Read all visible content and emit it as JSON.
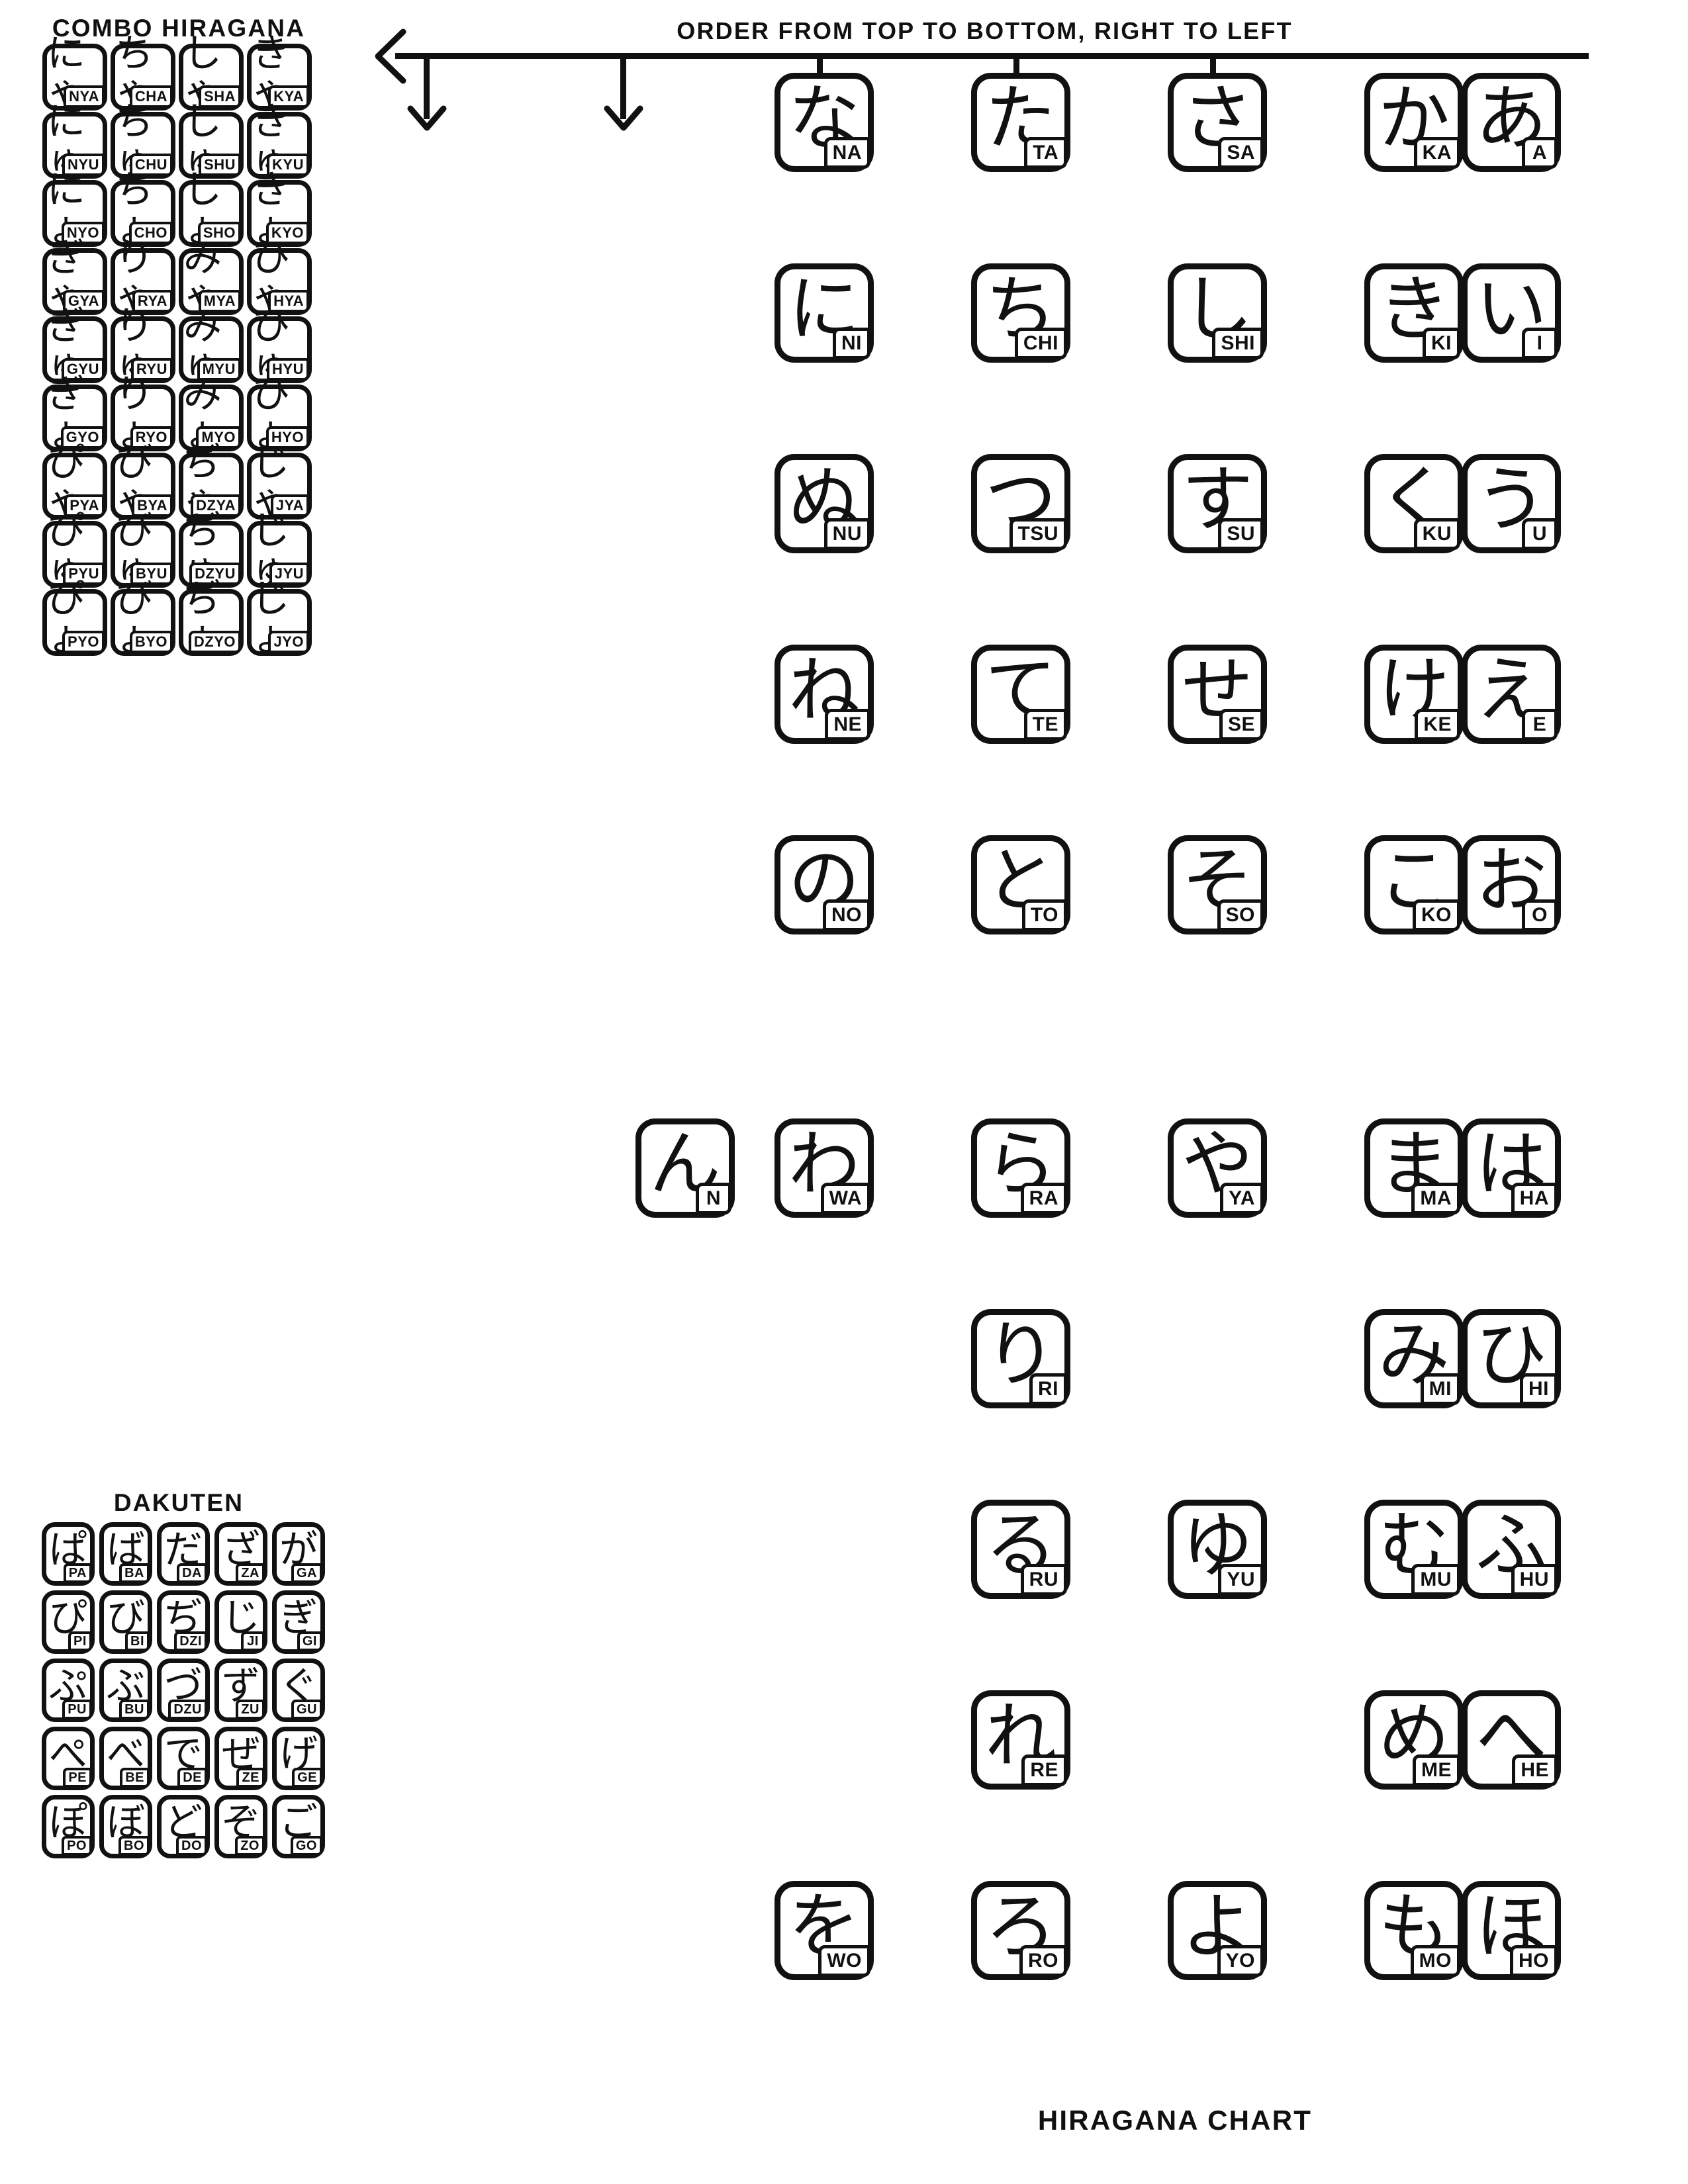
{
  "page": {
    "combo_title": "COMBO HIRAGANA",
    "dakuten_title": "DAKUTEN",
    "order_note": "ORDER FROM TOP TO BOTTOM, RIGHT TO LEFT",
    "chart_title": "HIRAGANA CHART",
    "ink_color": "#111111",
    "paper_color": "#ffffff"
  },
  "combo": {
    "columns": 4,
    "rows": [
      [
        {
          "kana": "にゃ",
          "romaji": "NYA"
        },
        {
          "kana": "ちゃ",
          "romaji": "CHA"
        },
        {
          "kana": "しゃ",
          "romaji": "SHA"
        },
        {
          "kana": "きゃ",
          "romaji": "KYA"
        }
      ],
      [
        {
          "kana": "にゅ",
          "romaji": "NYU"
        },
        {
          "kana": "ちゅ",
          "romaji": "CHU"
        },
        {
          "kana": "しゅ",
          "romaji": "SHU"
        },
        {
          "kana": "きゅ",
          "romaji": "KYU"
        }
      ],
      [
        {
          "kana": "にょ",
          "romaji": "NYO"
        },
        {
          "kana": "ちょ",
          "romaji": "CHO"
        },
        {
          "kana": "しょ",
          "romaji": "SHO"
        },
        {
          "kana": "きょ",
          "romaji": "KYO"
        }
      ],
      [
        {
          "kana": "ぎゃ",
          "romaji": "GYA"
        },
        {
          "kana": "りゃ",
          "romaji": "RYA"
        },
        {
          "kana": "みゃ",
          "romaji": "MYA"
        },
        {
          "kana": "ひゃ",
          "romaji": "HYA"
        }
      ],
      [
        {
          "kana": "ぎゅ",
          "romaji": "GYU"
        },
        {
          "kana": "りゅ",
          "romaji": "RYU"
        },
        {
          "kana": "みゅ",
          "romaji": "MYU"
        },
        {
          "kana": "ひゅ",
          "romaji": "HYU"
        }
      ],
      [
        {
          "kana": "ぎょ",
          "romaji": "GYO"
        },
        {
          "kana": "りょ",
          "romaji": "RYO"
        },
        {
          "kana": "みょ",
          "romaji": "MYO"
        },
        {
          "kana": "ひょ",
          "romaji": "HYO"
        }
      ],
      [
        {
          "kana": "ぴゃ",
          "romaji": "PYA"
        },
        {
          "kana": "びゃ",
          "romaji": "BYA"
        },
        {
          "kana": "ぢゃ",
          "romaji": "DZYA"
        },
        {
          "kana": "じゃ",
          "romaji": "JYA"
        }
      ],
      [
        {
          "kana": "ぴゅ",
          "romaji": "PYU"
        },
        {
          "kana": "びゅ",
          "romaji": "BYU"
        },
        {
          "kana": "ぢゅ",
          "romaji": "DZYU"
        },
        {
          "kana": "じゅ",
          "romaji": "JYU"
        }
      ],
      [
        {
          "kana": "ぴょ",
          "romaji": "PYO"
        },
        {
          "kana": "びょ",
          "romaji": "BYO"
        },
        {
          "kana": "ぢょ",
          "romaji": "DZYO"
        },
        {
          "kana": "じょ",
          "romaji": "JYO"
        }
      ]
    ]
  },
  "dakuten": {
    "columns": 5,
    "rows": [
      [
        {
          "kana": "ぱ",
          "romaji": "PA"
        },
        {
          "kana": "ば",
          "romaji": "BA"
        },
        {
          "kana": "だ",
          "romaji": "DA"
        },
        {
          "kana": "ざ",
          "romaji": "ZA"
        },
        {
          "kana": "が",
          "romaji": "GA"
        }
      ],
      [
        {
          "kana": "ぴ",
          "romaji": "PI"
        },
        {
          "kana": "び",
          "romaji": "BI"
        },
        {
          "kana": "ぢ",
          "romaji": "DZI"
        },
        {
          "kana": "じ",
          "romaji": "JI"
        },
        {
          "kana": "ぎ",
          "romaji": "GI"
        }
      ],
      [
        {
          "kana": "ぷ",
          "romaji": "PU"
        },
        {
          "kana": "ぶ",
          "romaji": "BU"
        },
        {
          "kana": "づ",
          "romaji": "DZU"
        },
        {
          "kana": "ず",
          "romaji": "ZU"
        },
        {
          "kana": "ぐ",
          "romaji": "GU"
        }
      ],
      [
        {
          "kana": "ぺ",
          "romaji": "PE"
        },
        {
          "kana": "べ",
          "romaji": "BE"
        },
        {
          "kana": "で",
          "romaji": "DE"
        },
        {
          "kana": "ぜ",
          "romaji": "ZE"
        },
        {
          "kana": "げ",
          "romaji": "GE"
        }
      ],
      [
        {
          "kana": "ぽ",
          "romaji": "PO"
        },
        {
          "kana": "ぼ",
          "romaji": "BO"
        },
        {
          "kana": "ど",
          "romaji": "DO"
        },
        {
          "kana": "ぞ",
          "romaji": "ZO"
        },
        {
          "kana": "ご",
          "romaji": "GO"
        }
      ]
    ]
  },
  "main": {
    "columns": 5,
    "column_order": [
      "NA",
      "TA",
      "SA",
      "KA",
      "A"
    ],
    "rows": [
      [
        {
          "kana": "な",
          "romaji": "NA"
        },
        {
          "kana": "た",
          "romaji": "TA"
        },
        {
          "kana": "さ",
          "romaji": "SA"
        },
        {
          "kana": "か",
          "romaji": "KA"
        },
        {
          "kana": "あ",
          "romaji": "A"
        }
      ],
      [
        {
          "kana": "に",
          "romaji": "NI"
        },
        {
          "kana": "ち",
          "romaji": "CHI"
        },
        {
          "kana": "し",
          "romaji": "SHI"
        },
        {
          "kana": "き",
          "romaji": "KI"
        },
        {
          "kana": "い",
          "romaji": "I"
        }
      ],
      [
        {
          "kana": "ぬ",
          "romaji": "NU"
        },
        {
          "kana": "つ",
          "romaji": "TSU"
        },
        {
          "kana": "す",
          "romaji": "SU"
        },
        {
          "kana": "く",
          "romaji": "KU"
        },
        {
          "kana": "う",
          "romaji": "U"
        }
      ],
      [
        {
          "kana": "ね",
          "romaji": "NE"
        },
        {
          "kana": "て",
          "romaji": "TE"
        },
        {
          "kana": "せ",
          "romaji": "SE"
        },
        {
          "kana": "け",
          "romaji": "KE"
        },
        {
          "kana": "え",
          "romaji": "E"
        }
      ],
      [
        {
          "kana": "の",
          "romaji": "NO"
        },
        {
          "kana": "と",
          "romaji": "TO"
        },
        {
          "kana": "そ",
          "romaji": "SO"
        },
        {
          "kana": "こ",
          "romaji": "KO"
        },
        {
          "kana": "お",
          "romaji": "O"
        }
      ],
      [
        {
          "kana": "わ",
          "romaji": "WA"
        },
        {
          "kana": "ら",
          "romaji": "RA"
        },
        {
          "kana": "や",
          "romaji": "YA"
        },
        {
          "kana": "ま",
          "romaji": "MA"
        },
        {
          "kana": "は",
          "romaji": "HA"
        }
      ],
      [
        {
          "kana": "り",
          "romaji": "RI"
        },
        {
          "kana": "",
          "romaji": ""
        },
        {
          "kana": "み",
          "romaji": "MI"
        },
        {
          "kana": "ひ",
          "romaji": "HI"
        }
      ],
      [
        {
          "kana": "る",
          "romaji": "RU"
        },
        {
          "kana": "ゆ",
          "romaji": "YU"
        },
        {
          "kana": "む",
          "romaji": "MU"
        },
        {
          "kana": "ふ",
          "romaji": "HU"
        }
      ],
      [
        {
          "kana": "れ",
          "romaji": "RE"
        },
        {
          "kana": "",
          "romaji": ""
        },
        {
          "kana": "め",
          "romaji": "ME"
        },
        {
          "kana": "へ",
          "romaji": "HE"
        }
      ],
      [
        {
          "kana": "を",
          "romaji": "WO"
        },
        {
          "kana": "ろ",
          "romaji": "RO"
        },
        {
          "kana": "よ",
          "romaji": "YO"
        },
        {
          "kana": "も",
          "romaji": "MO"
        },
        {
          "kana": "ほ",
          "romaji": "HO"
        }
      ]
    ],
    "standalone_n": {
      "kana": "ん",
      "romaji": "N"
    }
  }
}
